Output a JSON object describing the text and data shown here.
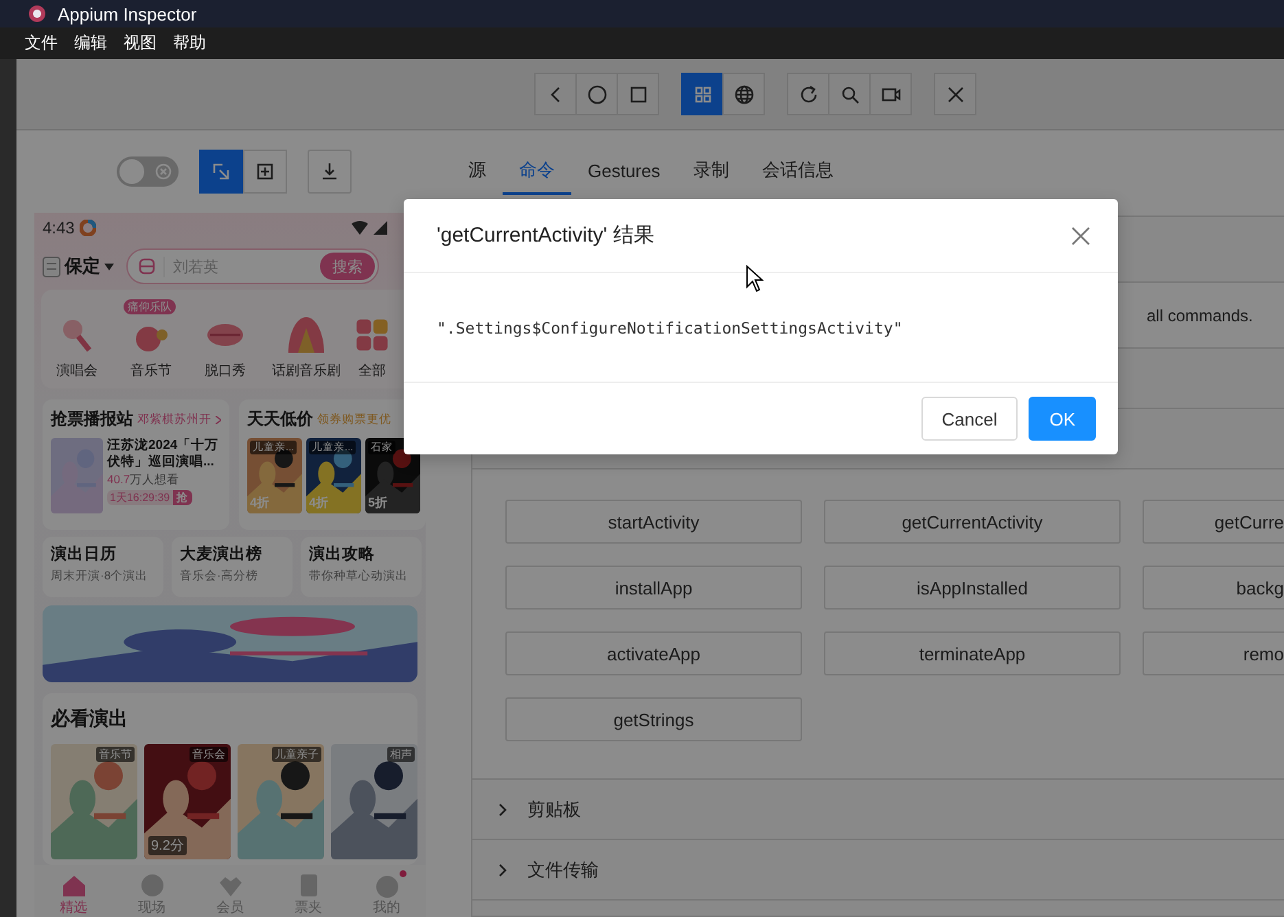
{
  "window": {
    "title": "Appium Inspector"
  },
  "menu": [
    "文件",
    "编辑",
    "视图",
    "帮助"
  ],
  "toolbar": {
    "groups": [
      [
        {
          "selected": false
        },
        {
          "selected": false
        },
        {
          "selected": false
        }
      ],
      [
        {
          "selected": true
        },
        {
          "selected": false
        }
      ],
      [
        {
          "selected": false
        },
        {
          "selected": false
        },
        {
          "selected": false
        }
      ],
      [
        {
          "selected": false
        }
      ]
    ]
  },
  "highlight_toggle": {
    "on": false
  },
  "modes": [
    {
      "selected": true
    },
    {
      "selected": false
    }
  ],
  "tabs": [
    {
      "label": "源",
      "selected": false
    },
    {
      "label": "命令",
      "selected": true
    },
    {
      "label": "Gestures",
      "selected": false
    },
    {
      "label": "录制",
      "selected": false
    },
    {
      "label": "会话信息",
      "selected": false
    }
  ],
  "phone": {
    "time": "4:43",
    "city": "保定",
    "search": {
      "placeholder": "刘若英",
      "button": "搜索"
    },
    "categories": [
      {
        "label": "演唱会"
      },
      {
        "label": "音乐节",
        "badge": "痛仰乐队"
      },
      {
        "label": "脱口秀"
      },
      {
        "label": "话剧音乐剧"
      },
      {
        "label": "全部"
      }
    ],
    "hot": {
      "title": "抢票播报站",
      "link": "邓紫棋苏州开",
      "show": "汪苏泷2024「十万伏特」巡回演唱...",
      "wanted_count": "40.7",
      "wanted_label": "万人想看",
      "countdown": "1天16:29:39",
      "grab": "抢"
    },
    "deals": {
      "title": "天天低价",
      "note": "领券购票更优",
      "items": [
        {
          "tag": "儿童亲...",
          "discount": "4折"
        },
        {
          "tag": "儿童亲...",
          "discount": "4折"
        },
        {
          "tag": "石家",
          "discount": "5折"
        }
      ]
    },
    "shortcuts": [
      {
        "title": "演出日历",
        "subtitle": "周末开演·8个演出"
      },
      {
        "title": "大麦演出榜",
        "subtitle": "音乐会·高分榜"
      },
      {
        "title": "演出攻略",
        "subtitle": "带你种草心动演出"
      }
    ],
    "must_see": {
      "title": "必看演出",
      "items": [
        {
          "tag": "音乐节"
        },
        {
          "tag": "音乐会",
          "score": "9.2分"
        },
        {
          "tag": "儿童亲子"
        },
        {
          "tag": "相声"
        }
      ]
    },
    "nav": [
      {
        "label": "精选",
        "selected": true,
        "dot": false
      },
      {
        "label": "现场",
        "selected": false,
        "dot": false
      },
      {
        "label": "会员",
        "selected": false,
        "dot": false
      },
      {
        "label": "票夹",
        "selected": false,
        "dot": false
      },
      {
        "label": "我的",
        "selected": false,
        "dot": true
      }
    ]
  },
  "panel": {
    "note": "all commands.",
    "commands": [
      "startActivity",
      "getCurrentActivity",
      "getCurre",
      "installApp",
      "isAppInstalled",
      "backg",
      "activateApp",
      "terminateApp",
      "remo",
      "getStrings"
    ],
    "sections": [
      {
        "title": "剪贴板",
        "expanded": false
      },
      {
        "title": "文件传输",
        "expanded": false
      }
    ]
  },
  "dialog": {
    "title": "'getCurrentActivity' 结果",
    "result": "\".Settings$ConfigureNotificationSettingsActivity\"",
    "buttons": [
      {
        "label": "Cancel",
        "kind": "default"
      },
      {
        "label": "OK",
        "kind": "primary"
      }
    ]
  }
}
